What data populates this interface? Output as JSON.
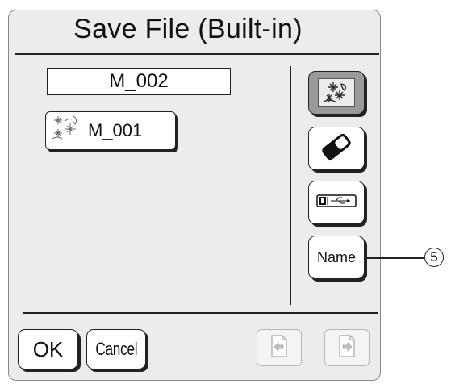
{
  "dialog": {
    "title": "Save File (Built-in)",
    "name_value": "M_002"
  },
  "files": [
    {
      "label": "M_001",
      "icon": "embroidery-flower-icon"
    }
  ],
  "side_buttons": [
    {
      "name": "embroidery-image-button",
      "icon": "embroidery-flower-icon",
      "active": true
    },
    {
      "name": "delete-button",
      "icon": "eraser-icon",
      "active": false
    },
    {
      "name": "usb-button",
      "icon": "usb-stick-icon",
      "active": false
    },
    {
      "name": "name-button",
      "label": "Name",
      "active": false
    }
  ],
  "bottom": {
    "ok_label": "OK",
    "cancel_label": "Cancel",
    "prev_icon": "page-prev-icon",
    "next_icon": "page-next-icon"
  },
  "callout": {
    "number": "5"
  },
  "colors": {
    "panel": "#ececec",
    "active_button": "#9a9a9a",
    "ink": "#222222"
  }
}
